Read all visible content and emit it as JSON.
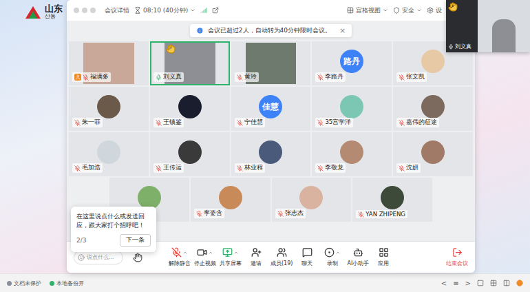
{
  "desktop": {
    "logo": "山东",
    "logo_sub": "산둥"
  },
  "window": {
    "title": "会议详情",
    "timer": "08:10 (40分钟)",
    "view_mode": "宫格视图",
    "security": "安全",
    "settings": "设"
  },
  "notice": {
    "text": "会议已超过2人，自动转为40分钟限时会议。",
    "close": "×"
  },
  "participants": [
    {
      "name": "福满多",
      "kind": "video",
      "color": "#c9a89a",
      "host": true,
      "muted": true,
      "hand_raised": false,
      "active": false
    },
    {
      "name": "刘义真",
      "kind": "video",
      "color": "#8d8f94",
      "host": false,
      "muted": false,
      "hand_raised": true,
      "active": true
    },
    {
      "name": "黄玲",
      "kind": "video",
      "color": "#6f7a6e",
      "host": false,
      "muted": true,
      "hand_raised": false,
      "active": false
    },
    {
      "name": "李路丹",
      "kind": "initials",
      "initials": "路丹",
      "color": "#3e82f7",
      "host": false,
      "muted": true,
      "hand_raised": false,
      "active": false
    },
    {
      "name": "张文凯",
      "kind": "avatar",
      "color": "#e8c9a5",
      "host": false,
      "muted": true,
      "hand_raised": false,
      "active": false
    },
    {
      "name": "朱一菲",
      "kind": "avatar",
      "color": "#6b5a4a",
      "host": false,
      "muted": true,
      "hand_raised": false,
      "active": false
    },
    {
      "name": "王镇鉴",
      "kind": "avatar",
      "color": "#1a1d2e",
      "host": false,
      "muted": true,
      "hand_raised": false,
      "active": false
    },
    {
      "name": "宁佳慧",
      "kind": "initials",
      "initials": "佳慧",
      "color": "#3e82f7",
      "host": false,
      "muted": true,
      "hand_raised": false,
      "active": false
    },
    {
      "name": "35宫学洋",
      "kind": "avatar",
      "color": "#7cc6b4",
      "host": false,
      "muted": true,
      "hand_raised": false,
      "active": false
    },
    {
      "name": "嘉伟的征途",
      "kind": "avatar",
      "color": "#7d6a5e",
      "host": false,
      "muted": true,
      "hand_raised": false,
      "active": false
    },
    {
      "name": "毛加浩",
      "kind": "avatar",
      "color": "#cfd6dc",
      "host": false,
      "muted": true,
      "hand_raised": false,
      "active": false
    },
    {
      "name": "王传运",
      "kind": "avatar",
      "color": "#3a3a3a",
      "host": false,
      "muted": true,
      "hand_raised": false,
      "active": false
    },
    {
      "name": "林业程",
      "kind": "avatar",
      "color": "#4a5a7a",
      "host": false,
      "muted": true,
      "hand_raised": false,
      "active": false
    },
    {
      "name": "李敬龙",
      "kind": "avatar",
      "color": "#b58a72",
      "host": false,
      "muted": true,
      "hand_raised": false,
      "active": false
    },
    {
      "name": "沈妍",
      "kind": "avatar",
      "color": "#a07a66",
      "host": false,
      "muted": true,
      "hand_raised": false,
      "active": false
    },
    {
      "name": "",
      "kind": "avatar",
      "color": "#7fb069",
      "host": false,
      "hand_raised": false,
      "active": false
    },
    {
      "name": "李姿含",
      "kind": "avatar",
      "color": "#c98a5a",
      "host": false,
      "muted": true,
      "hand_raised": false,
      "active": false
    },
    {
      "name": "张志杰",
      "kind": "avatar",
      "color": "#d9b3a0",
      "host": false,
      "muted": true,
      "hand_raised": false,
      "active": false
    },
    {
      "name": "YAN ZHIPENG",
      "kind": "avatar",
      "color": "#3d4a3a",
      "host": false,
      "muted": true,
      "hand_raised": false,
      "active": false
    }
  ],
  "floating_video": {
    "name": "刘义真",
    "hand_raised": true,
    "muted": false
  },
  "tip": {
    "text": "在这里说点什么或发送回应，跟大家打个招呼吧！",
    "page": "2/3",
    "button": "下一条"
  },
  "chat_input": {
    "placeholder": "说点什么..."
  },
  "toolbar": [
    {
      "label": "解除静音",
      "kind": "mic",
      "caret": true
    },
    {
      "label": "停止视频",
      "kind": "video",
      "caret": true
    },
    {
      "label": "共享屏幕",
      "kind": "share",
      "caret": true
    },
    {
      "label": "邀请",
      "kind": "invite",
      "caret": false
    },
    {
      "label": "成员(19)",
      "kind": "members",
      "caret": false
    },
    {
      "label": "聊天",
      "kind": "chat",
      "caret": false
    },
    {
      "label": "录制",
      "kind": "record",
      "caret": true
    },
    {
      "label": "AI小助手",
      "kind": "ai",
      "caret": false
    },
    {
      "label": "应用",
      "kind": "apps",
      "caret": false
    }
  ],
  "end_button": "结束会议",
  "status_bar": {
    "items": [
      {
        "label": "文档未保护",
        "color": "#8a8f99"
      },
      {
        "label": "本地备份开",
        "color": "#2fb36b"
      }
    ],
    "nav": [
      "<",
      "≡",
      ">"
    ]
  }
}
